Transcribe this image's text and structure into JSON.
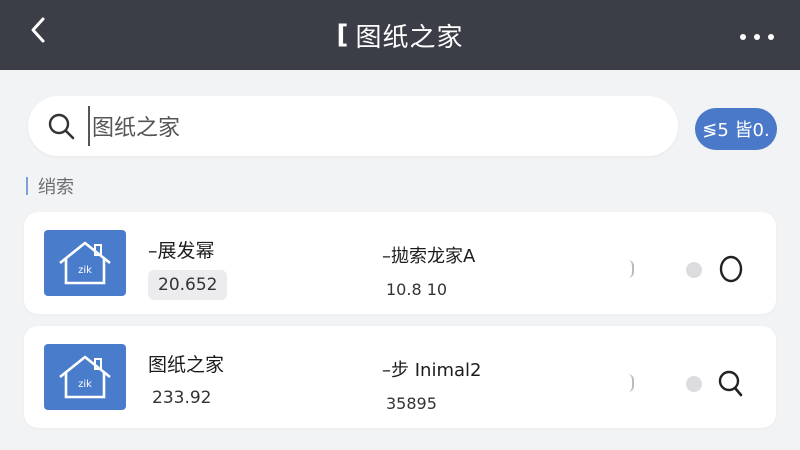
{
  "header": {
    "title_bracket": "[",
    "title": "图纸之家"
  },
  "search": {
    "value": "图纸之家",
    "button_label": "≶5 皆0."
  },
  "section": {
    "label": "绡索"
  },
  "results": [
    {
      "name": "–展发幂",
      "value": "20.652",
      "col_title": "–拋索龙家A",
      "col_value": "10.8 10",
      "action_icon": "circle-icon"
    },
    {
      "name": "图纸之家",
      "value": "233.92",
      "col_title": "–步 Inimal2",
      "col_value": "35895",
      "action_icon": "search-icon"
    }
  ],
  "colors": {
    "header_bg": "#3b3e46",
    "accent": "#4a79c9",
    "page_bg": "#f2f3f5"
  }
}
